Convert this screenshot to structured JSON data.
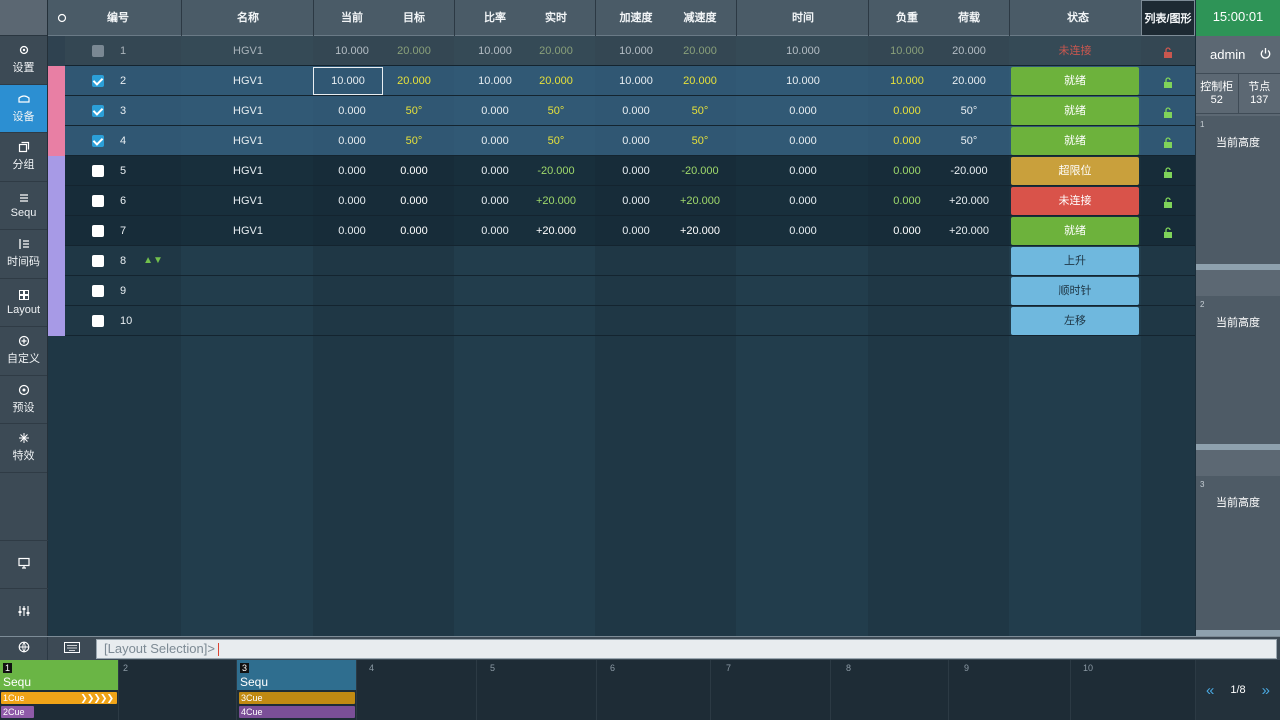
{
  "sidebar": {
    "items": [
      {
        "label": "设置",
        "icon": "settings-icon"
      },
      {
        "label": "设备",
        "icon": "device-icon",
        "active": true
      },
      {
        "label": "分组",
        "icon": "group-icon"
      },
      {
        "label": "Sequ",
        "icon": "sequence-icon"
      },
      {
        "label": "时间码",
        "icon": "timecode-icon"
      },
      {
        "label": "Layout",
        "icon": "layout-icon"
      },
      {
        "label": "自定义",
        "icon": "custom-icon"
      },
      {
        "label": "预设",
        "icon": "preset-icon"
      },
      {
        "label": "特效",
        "icon": "effects-icon"
      }
    ],
    "bottom_icons": [
      "monitor-icon",
      "mixer-icon"
    ]
  },
  "table": {
    "headers": {
      "id": "编号",
      "name": "名称",
      "current": "当前",
      "target": "目标",
      "ratio": "比率",
      "realtime": "实时",
      "accel": "加速度",
      "decel": "减速度",
      "time": "时间",
      "load": "负重",
      "payload": "荷载",
      "status": "状态",
      "view": "列表/图形"
    },
    "rows": [
      {
        "id": "1",
        "name": "HGV1",
        "current": "10.000",
        "target": "20.000",
        "ratio": "10.000",
        "realtime": "20.000",
        "accel": "10.000",
        "decel": "20.000",
        "time": "10.000",
        "load": "10.000",
        "payload": "20.000",
        "status": "未连接",
        "state": "disconnected-dim"
      },
      {
        "id": "2",
        "name": "HGV1",
        "current": "10.000",
        "target": "20.000",
        "ratio": "10.000",
        "realtime": "20.000",
        "accel": "10.000",
        "decel": "20.000",
        "time": "10.000",
        "load": "10.000",
        "payload": "20.000",
        "status": "就绪",
        "state": "ready"
      },
      {
        "id": "3",
        "name": "HGV1",
        "current": "0.000",
        "target": "50°",
        "ratio": "0.000",
        "realtime": "50°",
        "accel": "0.000",
        "decel": "50°",
        "time": "0.000",
        "load": "0.000",
        "payload": "50°",
        "status": "就绪",
        "state": "ready"
      },
      {
        "id": "4",
        "name": "HGV1",
        "current": "0.000",
        "target": "50°",
        "ratio": "0.000",
        "realtime": "50°",
        "accel": "0.000",
        "decel": "50°",
        "time": "0.000",
        "load": "0.000",
        "payload": "50°",
        "status": "就绪",
        "state": "ready"
      },
      {
        "id": "5",
        "name": "HGV1",
        "current": "0.000",
        "target": "0.000",
        "ratio": "0.000",
        "realtime": "-20.000",
        "accel": "0.000",
        "decel": "-20.000",
        "time": "0.000",
        "load": "0.000",
        "payload": "-20.000",
        "status": "超限位",
        "state": "overlimit"
      },
      {
        "id": "6",
        "name": "HGV1",
        "current": "0.000",
        "target": "0.000",
        "ratio": "0.000",
        "realtime": "+20.000",
        "accel": "0.000",
        "decel": "+20.000",
        "time": "0.000",
        "load": "0.000",
        "payload": "+20.000",
        "status": "未连接",
        "state": "disconnected"
      },
      {
        "id": "7",
        "name": "HGV1",
        "current": "0.000",
        "target": "0.000",
        "ratio": "0.000",
        "realtime": "+20.000",
        "accel": "0.000",
        "decel": "+20.000",
        "time": "0.000",
        "load": "0.000",
        "payload": "+20.000",
        "status": "就绪",
        "state": "ready"
      },
      {
        "id": "8",
        "status": "上升",
        "state": "action"
      },
      {
        "id": "9",
        "status": "顺时针",
        "state": "action"
      },
      {
        "id": "10",
        "status": "左移",
        "state": "action"
      }
    ]
  },
  "right_panel": {
    "clock": "15:00:01",
    "user": "admin",
    "cabinet_label": "控制柜",
    "cabinet_value": "52",
    "node_label": "节点",
    "node_value": "137",
    "height_cards": [
      {
        "num": "1",
        "label": "当前高度"
      },
      {
        "num": "2",
        "label": "当前高度"
      },
      {
        "num": "3",
        "label": "当前高度"
      }
    ]
  },
  "command": {
    "placeholder": "[Layout Selection]>"
  },
  "cue_strip": {
    "slots": [
      {
        "num": "1",
        "name": "Sequ",
        "cues": [
          "1Cue",
          "2Cue"
        ]
      },
      {
        "num": "2"
      },
      {
        "num": "3",
        "name": "Sequ",
        "cues": [
          "3Cue",
          "4Cue"
        ]
      },
      {
        "num": "4"
      },
      {
        "num": "5"
      },
      {
        "num": "6"
      },
      {
        "num": "7"
      },
      {
        "num": "8"
      },
      {
        "num": "9"
      },
      {
        "num": "10"
      }
    ],
    "page": "1/8"
  },
  "colors": {
    "ready": "#6db23c",
    "overlimit": "#c9a03c",
    "disconnected": "#d9534a",
    "action": "#6fb8de",
    "active_nav": "#2c8fd2",
    "highlight_value": "#e6e03a",
    "green_value": "#9fd86b"
  }
}
